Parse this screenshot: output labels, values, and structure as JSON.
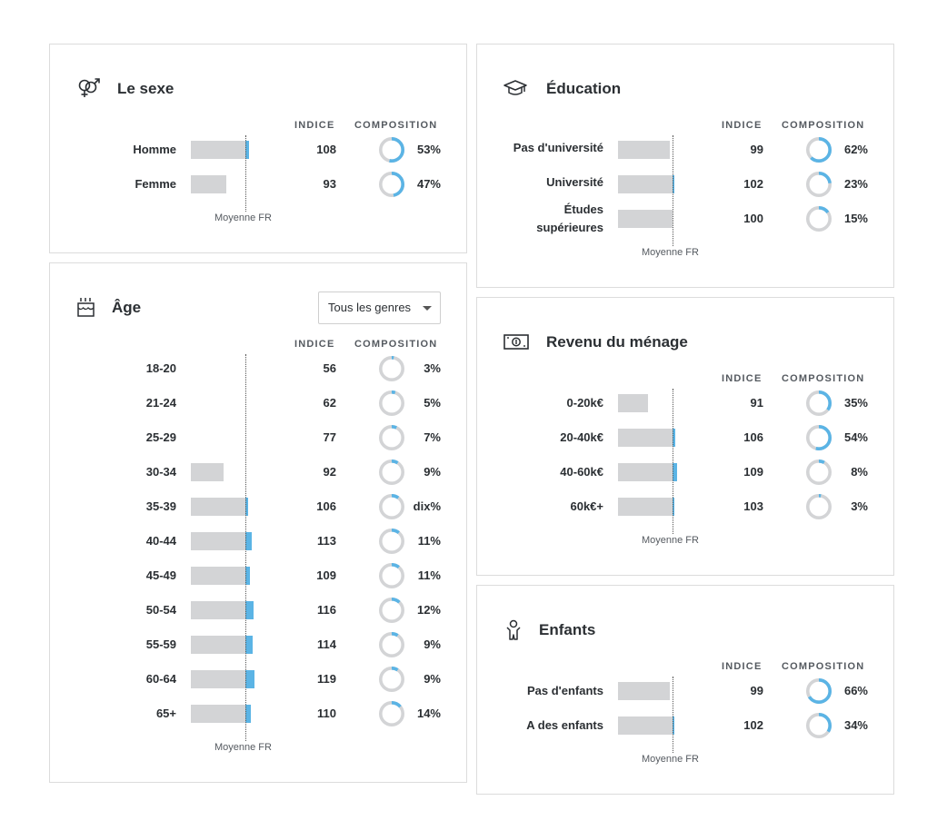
{
  "avg_label": "Moyenne FR",
  "col_indice": "INDICE",
  "col_composition": "COMPOSITION",
  "colors": {
    "bar": "#d3d4d6",
    "accent": "#5bb4e5",
    "donut_track": "#d3d4d6"
  },
  "sexe": {
    "title": "Le sexe",
    "icon": "gender-icon",
    "rows": [
      {
        "label": "Homme",
        "indice": "108",
        "indice_value": 108,
        "pct": "53%",
        "pct_value": 53
      },
      {
        "label": "Femme",
        "indice": "93",
        "indice_value": 93,
        "pct": "47%",
        "pct_value": 47
      }
    ]
  },
  "age": {
    "title": "Âge",
    "icon": "birthday-cake-icon",
    "dropdown": "Tous les genres",
    "rows": [
      {
        "label": "18-20",
        "indice": "56",
        "indice_value": 56,
        "pct": "3%",
        "pct_value": 3
      },
      {
        "label": "21-24",
        "indice": "62",
        "indice_value": 62,
        "pct": "5%",
        "pct_value": 5
      },
      {
        "label": "25-29",
        "indice": "77",
        "indice_value": 77,
        "pct": "7%",
        "pct_value": 7
      },
      {
        "label": "30-34",
        "indice": "92",
        "indice_value": 92,
        "pct": "9%",
        "pct_value": 9
      },
      {
        "label": "35-39",
        "indice": "106",
        "indice_value": 106,
        "pct": "dix%",
        "pct_value": 10
      },
      {
        "label": "40-44",
        "indice": "113",
        "indice_value": 113,
        "pct": "11%",
        "pct_value": 11
      },
      {
        "label": "45-49",
        "indice": "109",
        "indice_value": 109,
        "pct": "11%",
        "pct_value": 11
      },
      {
        "label": "50-54",
        "indice": "116",
        "indice_value": 116,
        "pct": "12%",
        "pct_value": 12
      },
      {
        "label": "55-59",
        "indice": "114",
        "indice_value": 114,
        "pct": "9%",
        "pct_value": 9
      },
      {
        "label": "60-64",
        "indice": "119",
        "indice_value": 119,
        "pct": "9%",
        "pct_value": 9
      },
      {
        "label": "65+",
        "indice": "110",
        "indice_value": 110,
        "pct": "14%",
        "pct_value": 14
      }
    ]
  },
  "education": {
    "title": "Éducation",
    "icon": "graduation-cap-icon",
    "rows": [
      {
        "label": "Pas d'université",
        "indice": "99",
        "indice_value": 99,
        "pct": "62%",
        "pct_value": 62
      },
      {
        "label": "Université",
        "indice": "102",
        "indice_value": 102,
        "pct": "23%",
        "pct_value": 23
      },
      {
        "label": "Études supérieures",
        "indice": "100",
        "indice_value": 100,
        "pct": "15%",
        "pct_value": 15
      }
    ]
  },
  "revenu": {
    "title": "Revenu du ménage",
    "icon": "banknote-icon",
    "rows": [
      {
        "label": "0-20k€",
        "indice": "91",
        "indice_value": 91,
        "pct": "35%",
        "pct_value": 35
      },
      {
        "label": "20-40k€",
        "indice": "106",
        "indice_value": 106,
        "pct": "54%",
        "pct_value": 54
      },
      {
        "label": "40-60k€",
        "indice": "109",
        "indice_value": 109,
        "pct": "8%",
        "pct_value": 8
      },
      {
        "label": "60k€+",
        "indice": "103",
        "indice_value": 103,
        "pct": "3%",
        "pct_value": 3
      }
    ]
  },
  "enfants": {
    "title": "Enfants",
    "icon": "child-icon",
    "rows": [
      {
        "label": "Pas d'enfants",
        "indice": "99",
        "indice_value": 99,
        "pct": "66%",
        "pct_value": 66
      },
      {
        "label": "A des enfants",
        "indice": "102",
        "indice_value": 102,
        "pct": "34%",
        "pct_value": 34
      }
    ]
  }
}
